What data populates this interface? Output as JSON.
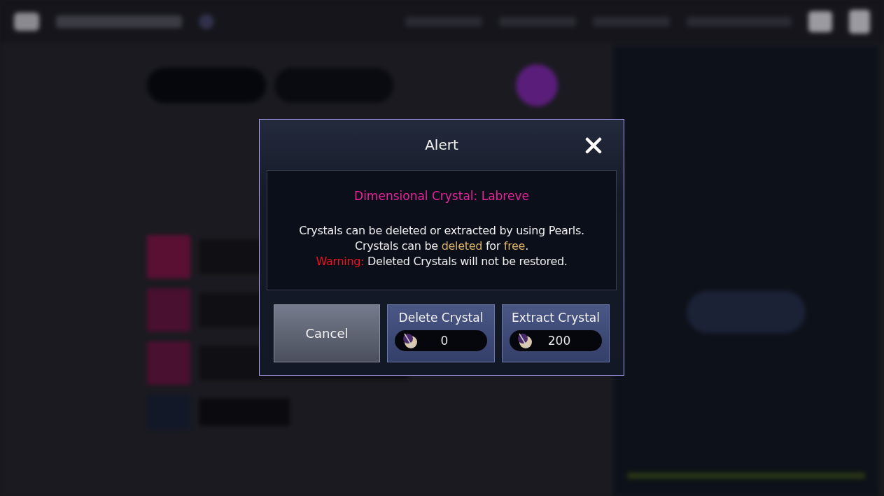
{
  "dialog": {
    "title": "Alert",
    "crystal_name": "Dimensional Crystal: Labreve",
    "lines": [
      [
        {
          "text": "Crystals can be deleted or extracted by using Pearls.",
          "kind": "plain"
        }
      ],
      [
        {
          "text": "Crystals can be ",
          "kind": "plain"
        },
        {
          "text": "deleted",
          "kind": "highlight"
        },
        {
          "text": " for ",
          "kind": "plain"
        },
        {
          "text": "free",
          "kind": "highlight"
        },
        {
          "text": ".",
          "kind": "plain"
        }
      ],
      [
        {
          "text": "Warning:",
          "kind": "warning"
        },
        {
          "text": " Deleted Crystals will not be restored.",
          "kind": "plain"
        }
      ]
    ],
    "buttons": [
      {
        "kind": "cancel",
        "label": "Cancel"
      },
      {
        "kind": "cost",
        "label": "Delete Crystal",
        "cost": "0"
      },
      {
        "kind": "cost",
        "label": "Extract Crystal",
        "cost": "200"
      }
    ]
  }
}
